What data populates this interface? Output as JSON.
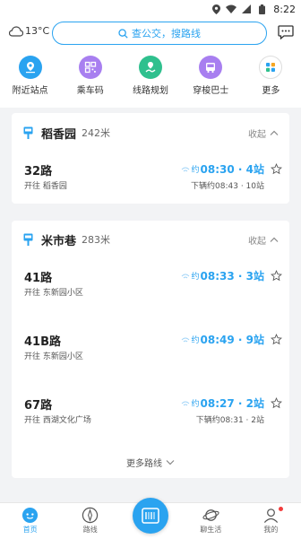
{
  "status_bar": {
    "time": "8:22"
  },
  "header": {
    "weather": {
      "temp": "13°C",
      "icon": "cloud-icon"
    },
    "search": {
      "placeholder": "查公交，搜路线"
    },
    "message_icon": "message-icon"
  },
  "quick_actions": [
    {
      "label": "附近站点",
      "icon": "nearby-stop-icon",
      "color": "#2aa3f0"
    },
    {
      "label": "乘车码",
      "icon": "qr-code-icon",
      "color": "#a87ff0"
    },
    {
      "label": "线路规划",
      "icon": "route-plan-icon",
      "color": "#2fc08e"
    },
    {
      "label": "穿梭巴士",
      "icon": "shuttle-bus-icon",
      "color": "#a87ff0"
    },
    {
      "label": "更多",
      "icon": "more-icon",
      "color": "#2aa3f0"
    }
  ],
  "stations": [
    {
      "name": "稻香园",
      "distance": "242米",
      "toggle": "收起",
      "routes": [
        {
          "name": "32路",
          "direction": "开往 稻香园",
          "eta_prefix": "约",
          "eta": "08:30 · 4站",
          "next": "下辆约08:43 · 10站"
        }
      ]
    },
    {
      "name": "米市巷",
      "distance": "283米",
      "toggle": "收起",
      "routes": [
        {
          "name": "41路",
          "direction": "开往 东新园小区",
          "eta_prefix": "约",
          "eta": "08:33 · 3站",
          "next": ""
        },
        {
          "name": "41B路",
          "direction": "开往 东新园小区",
          "eta_prefix": "约",
          "eta": "08:49 · 9站",
          "next": ""
        },
        {
          "name": "67路",
          "direction": "开往 西湖文化广场",
          "eta_prefix": "约",
          "eta": "08:27 · 2站",
          "next": "下辆约08:31 · 2站"
        }
      ],
      "more_routes": "更多路线"
    }
  ],
  "tabbar": [
    {
      "label": "首页",
      "icon": "home-icon",
      "active": true
    },
    {
      "label": "路线",
      "icon": "compass-icon",
      "active": false
    },
    {
      "label": "",
      "icon": "scan-icon",
      "active": false
    },
    {
      "label": "聊生活",
      "icon": "planet-icon",
      "active": false
    },
    {
      "label": "我的",
      "icon": "profile-icon",
      "active": false
    }
  ],
  "colors": {
    "accent": "#2aa3f0",
    "background": "#f2f3f5",
    "badge": "#f23c3c"
  }
}
